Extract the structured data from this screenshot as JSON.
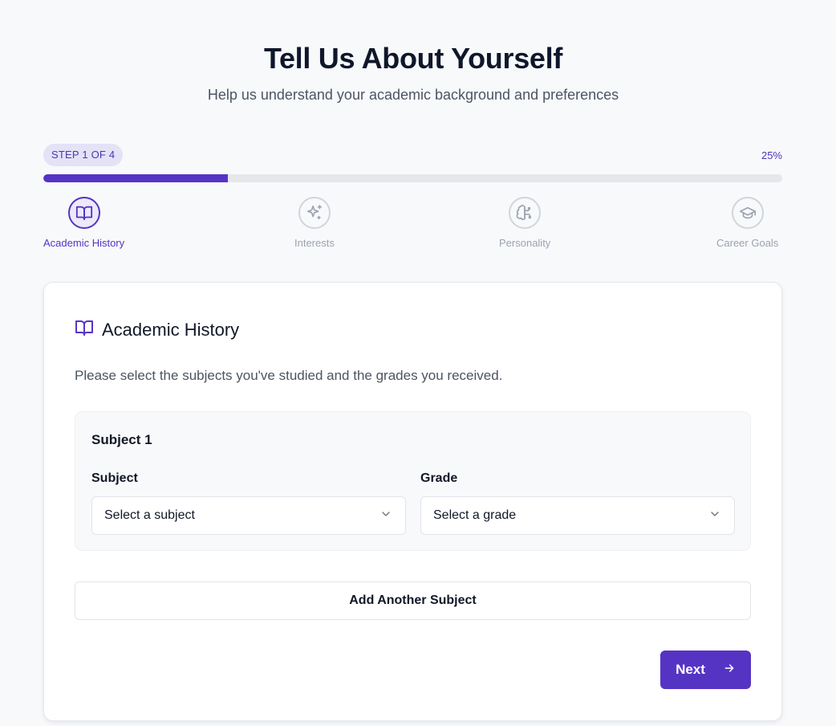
{
  "header": {
    "title": "Tell Us About Yourself",
    "subtitle": "Help us understand your academic background and preferences"
  },
  "progress": {
    "step_label": "STEP 1 OF 4",
    "percent_label": "25%",
    "fraction": 0.25
  },
  "steps": [
    {
      "label": "Academic History",
      "icon": "book-open-icon",
      "active": true
    },
    {
      "label": "Interests",
      "icon": "sparkles-icon",
      "active": false
    },
    {
      "label": "Personality",
      "icon": "brain-icon",
      "active": false
    },
    {
      "label": "Career Goals",
      "icon": "graduation-cap-icon",
      "active": false
    }
  ],
  "card": {
    "title": "Academic History",
    "icon": "book-open-icon",
    "description": "Please select the subjects you've studied and the grades you received.",
    "subject_block": {
      "heading": "Subject 1",
      "subject_label": "Subject",
      "subject_placeholder": "Select a subject",
      "grade_label": "Grade",
      "grade_placeholder": "Select a grade"
    },
    "add_button": "Add Another Subject",
    "next_button": "Next"
  },
  "colors": {
    "accent": "#5534c4",
    "accent_soft": "#e4e2f6",
    "inactive": "#9ca3af"
  }
}
